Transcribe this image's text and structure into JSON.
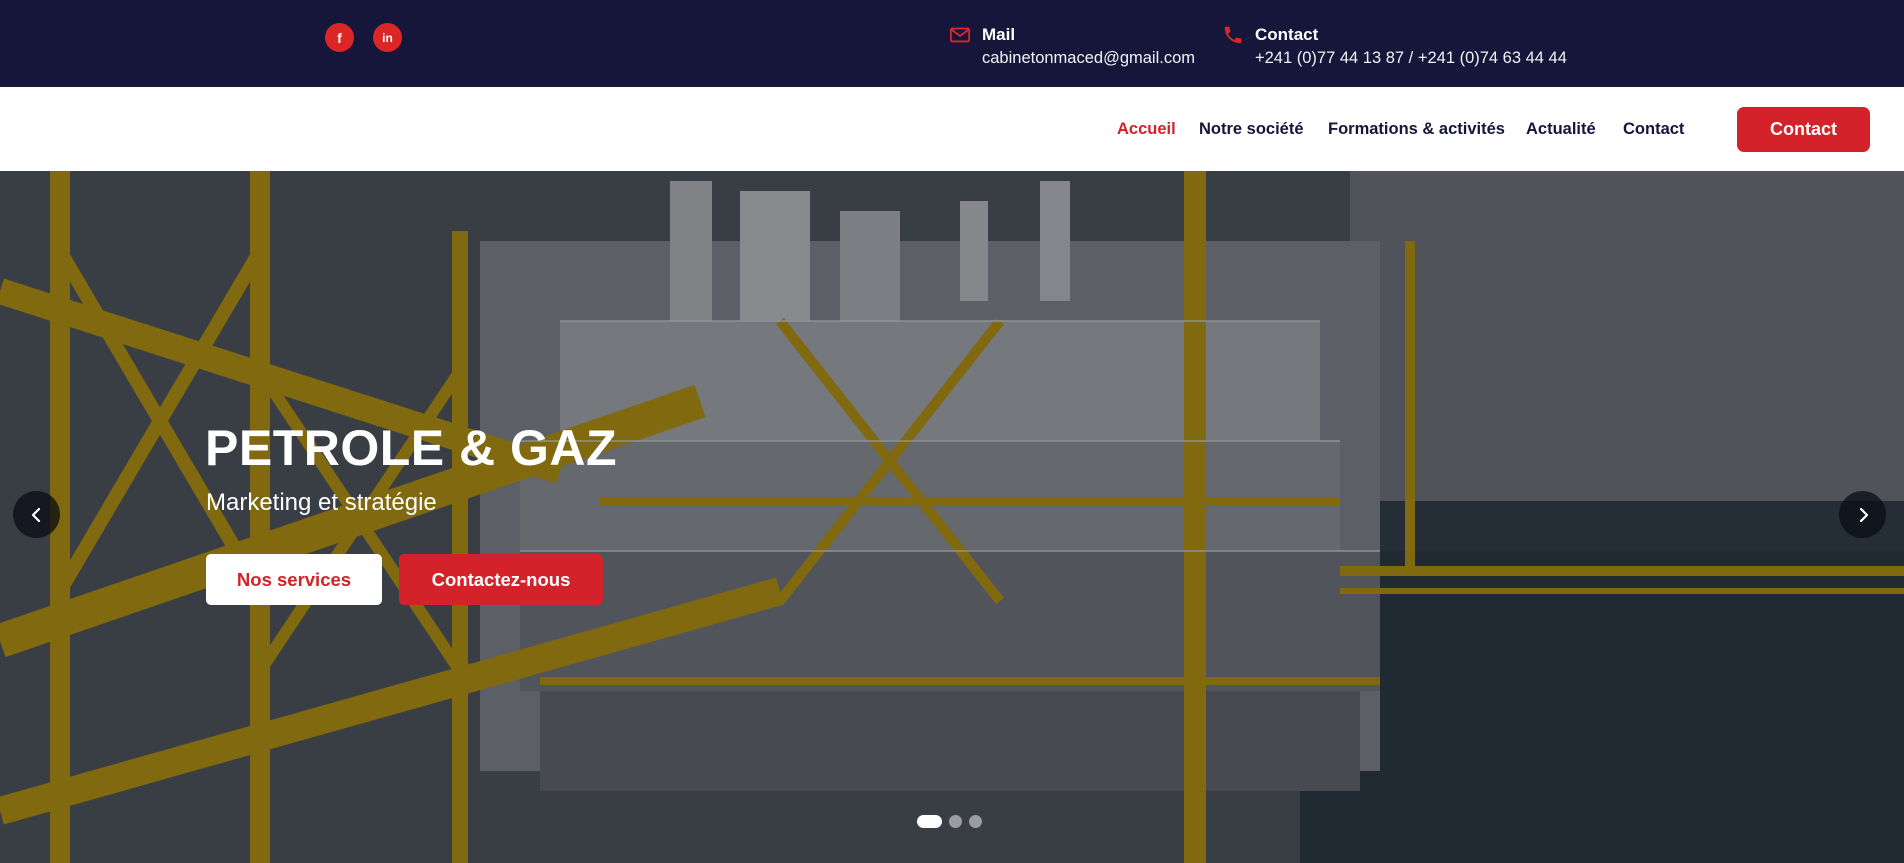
{
  "colors": {
    "topbar_bg": "#15163a",
    "accent_red": "#d4222a",
    "nav_text": "#15163a"
  },
  "topbar": {
    "social": [
      {
        "icon": "facebook-icon",
        "glyph": "f"
      },
      {
        "icon": "linkedin-icon",
        "glyph": "in"
      }
    ],
    "mail": {
      "icon": "mail-icon",
      "title": "Mail",
      "value": "cabinetonmaced@gmail.com"
    },
    "phone": {
      "icon": "phone-icon",
      "title": "Contact",
      "value": "+241 (0)77 44 13 87 / +241 (0)74 63 44 44"
    }
  },
  "nav": {
    "items": [
      {
        "label": "Accueil",
        "active": true
      },
      {
        "label": "Notre société",
        "active": false
      },
      {
        "label": "Formations & activités",
        "active": false
      },
      {
        "label": "Actualité",
        "active": false
      },
      {
        "label": "Contact",
        "active": false
      }
    ],
    "cta_label": "Contact"
  },
  "hero": {
    "title": "PETROLE & GAZ",
    "subtitle": "Marketing et stratégie",
    "primary_button": "Nos services",
    "secondary_button": "Contactez-nous",
    "prev_icon": "chevron-left-icon",
    "next_icon": "chevron-right-icon",
    "slides_count": 3,
    "active_slide": 1
  }
}
